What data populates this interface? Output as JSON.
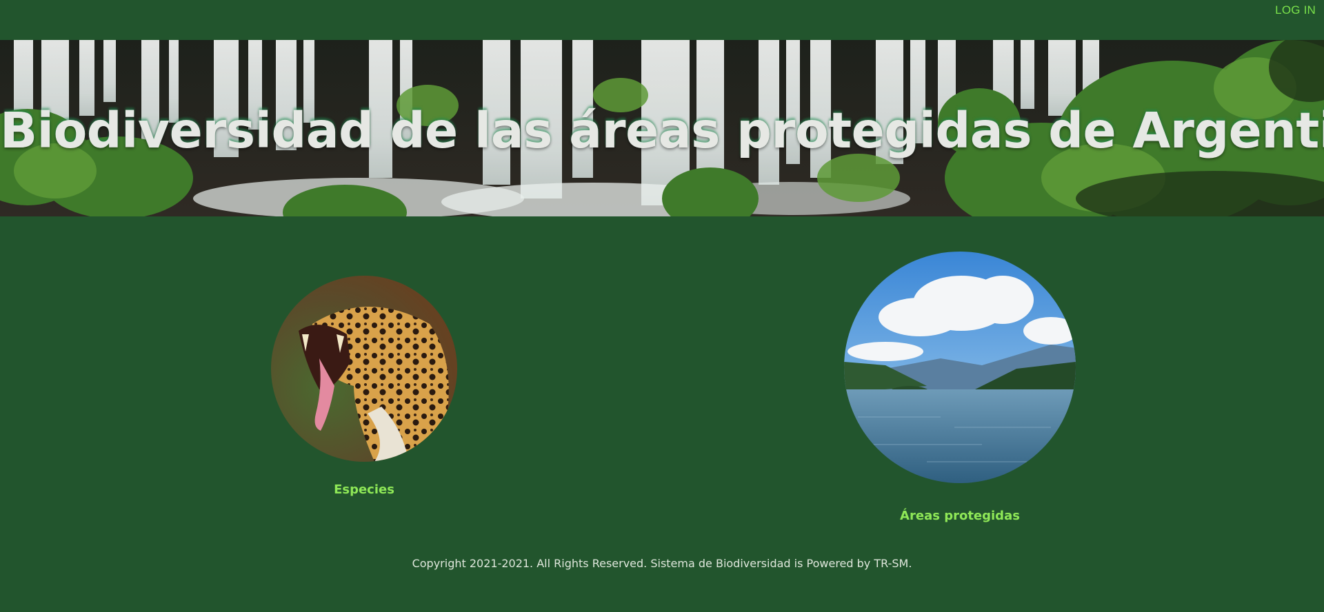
{
  "header": {
    "login_label": "LOG IN"
  },
  "hero": {
    "title": "Biodiversidad de las áreas protegidas de Argentina",
    "background_image": "waterfall-banner"
  },
  "cards": [
    {
      "label": "Especies",
      "image": "jaguar-photo"
    },
    {
      "label": "Áreas protegidas",
      "image": "lake-mountains-photo"
    }
  ],
  "footer": {
    "copyright": "Copyright 2021-2021. All Rights Reserved. Sistema de Biodiversidad is Powered by TR-SM."
  },
  "colors": {
    "background": "#22552d",
    "accent_link": "#7be24b",
    "card_label": "#8fe857",
    "title_text": "#e6e8e4"
  }
}
